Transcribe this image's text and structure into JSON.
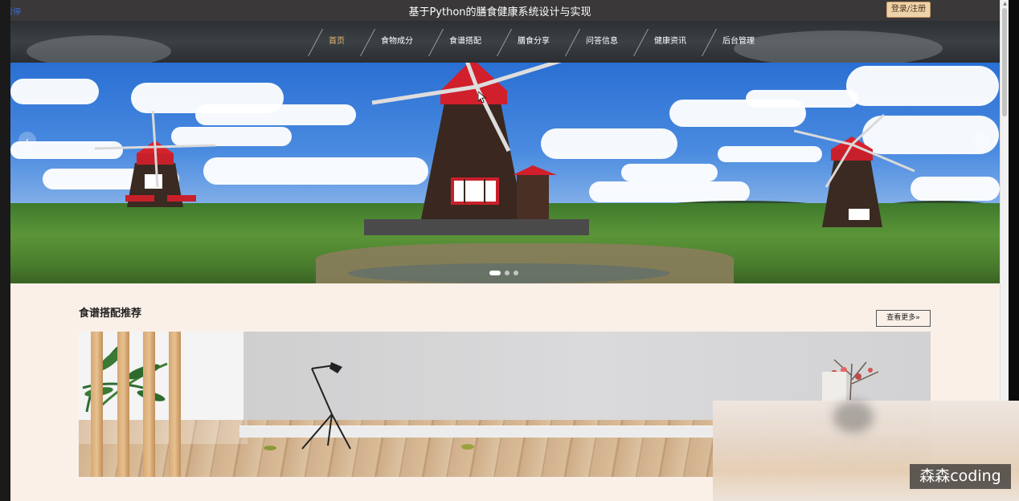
{
  "topbar": {
    "pause_link": "暂停",
    "title": "基于Python的膳食健康系统设计与实现",
    "login_label": "登录/注册"
  },
  "nav": {
    "items": [
      {
        "label": "首页",
        "active": true
      },
      {
        "label": "食物成分",
        "active": false
      },
      {
        "label": "食谱搭配",
        "active": false
      },
      {
        "label": "膳食分享",
        "active": false
      },
      {
        "label": "问答信息",
        "active": false
      },
      {
        "label": "健康资讯",
        "active": false
      },
      {
        "label": "后台管理",
        "active": false
      }
    ]
  },
  "banner": {
    "prev_icon": "‹",
    "next_icon": "›",
    "slide_count": 3,
    "active_slide": 1
  },
  "recipes": {
    "title": "食谱搭配推荐",
    "more_label": "查看更多",
    "more_icon": "»"
  },
  "watermark": "森森coding",
  "colors": {
    "accent": "#e8b87a",
    "topbar_bg": "#3a3838",
    "login_bg": "#efd3a8",
    "page_bg": "#faf0e8"
  }
}
